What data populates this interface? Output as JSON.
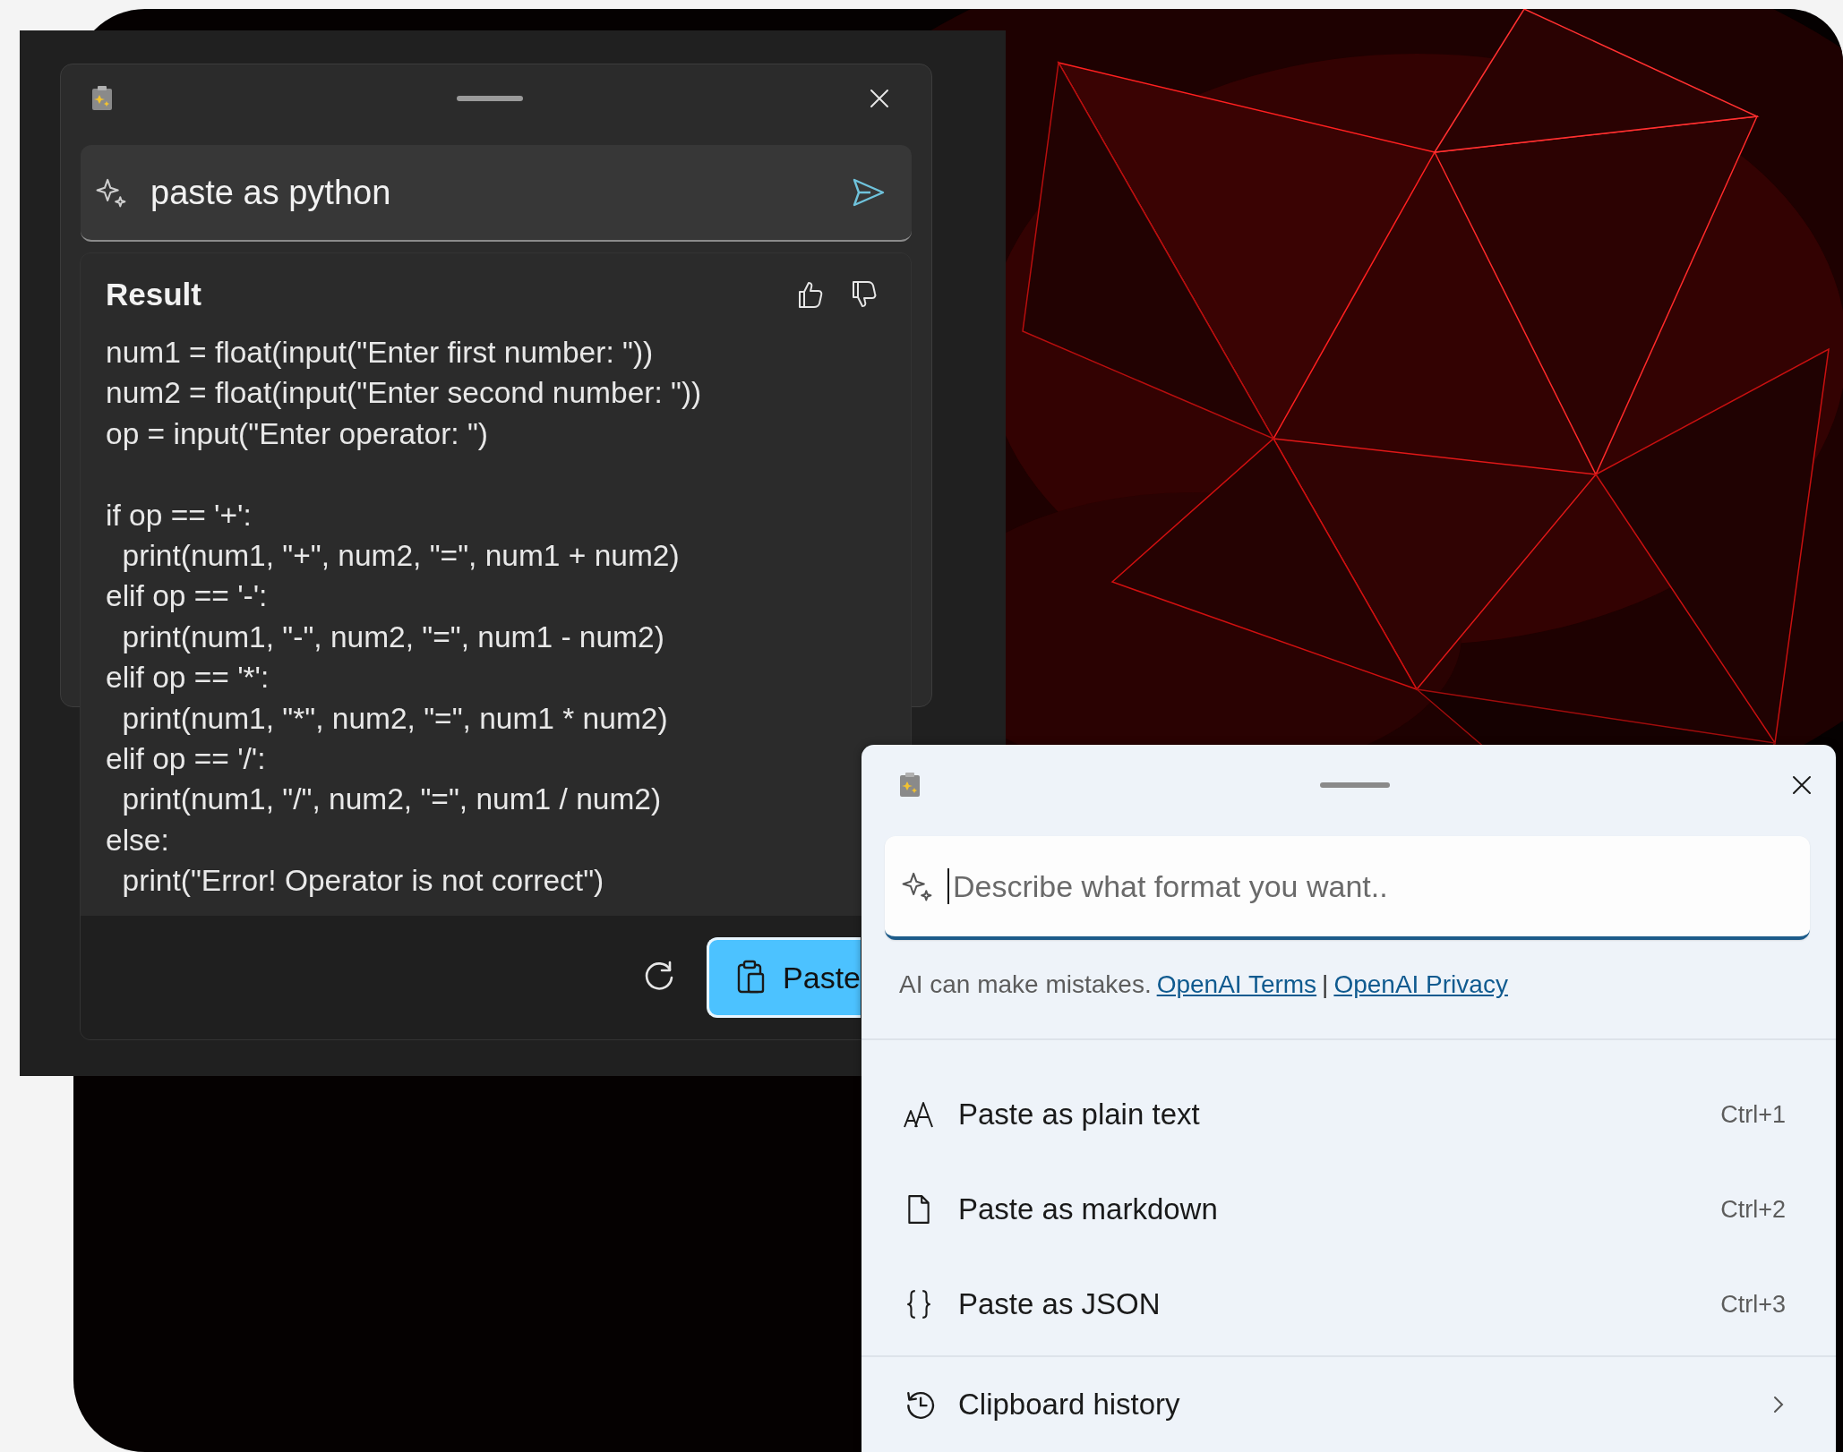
{
  "result_window": {
    "query": "paste as python",
    "result_title": "Result",
    "code": "num1 = float(input(\"Enter first number: \"))\nnum2 = float(input(\"Enter second number: \"))\nop = input(\"Enter operator: \")\n\nif op == '+':\n  print(num1, \"+\", num2, \"=\", num1 + num2)\nelif op == '-':\n  print(num1, \"-\", num2, \"=\", num1 - num2)\nelif op == '*':\n  print(num1, \"*\", num2, \"=\", num1 * num2)\nelif op == '/':\n  print(num1, \"/\", num2, \"=\", num1 / num2)\nelse:\n  print(\"Error! Operator is not correct\")",
    "paste_button": "Paste"
  },
  "paste_window": {
    "input": {
      "placeholder": "Describe what format you want..",
      "focused": true
    },
    "disclaimer": "AI can make mistakes.",
    "links": [
      "OpenAI Terms",
      "OpenAI Privacy"
    ],
    "link_separator": "|",
    "items": [
      {
        "kind": "text",
        "label": "Paste as plain text",
        "shortcut": "Ctrl+1",
        "submenu": false
      },
      {
        "kind": "markdown",
        "label": "Paste as markdown",
        "shortcut": "Ctrl+2",
        "submenu": false
      },
      {
        "kind": "json",
        "label": "Paste as JSON",
        "shortcut": "Ctrl+3",
        "submenu": false
      },
      {
        "kind": "history",
        "label": "Clipboard history",
        "submenu": true
      }
    ]
  }
}
